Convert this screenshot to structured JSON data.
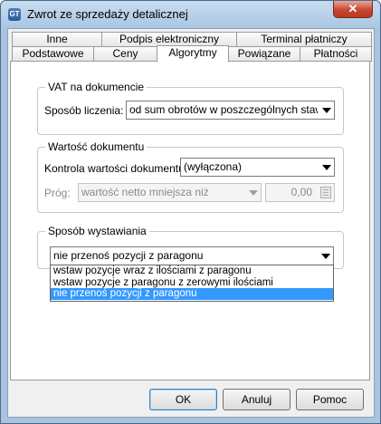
{
  "window": {
    "title": "Zwrot ze sprzedaży detalicznej",
    "close_glyph": "✕",
    "app_icon_text": "GT"
  },
  "tabs_row1": [
    {
      "label": "Inne"
    },
    {
      "label": "Podpis elektroniczny"
    },
    {
      "label": "Terminal płatniczy"
    }
  ],
  "tabs_row2": [
    {
      "label": "Podstawowe"
    },
    {
      "label": "Ceny"
    },
    {
      "label": "Algorytmy"
    },
    {
      "label": "Powiązane"
    },
    {
      "label": "Płatności"
    }
  ],
  "active_tab": "Algorytmy",
  "vat": {
    "legend": "VAT na dokumencie",
    "method_label": "Sposób liczenia:",
    "method_value": "od sum obrotów w poszczególnych stawkac"
  },
  "value": {
    "legend": "Wartość dokumentu",
    "control_label": "Kontrola wartości dokumentu:",
    "control_value": "(wyłączona)",
    "threshold_label": "Próg:",
    "threshold_type": "wartość netto mniejsza niż",
    "threshold_amount": "0,00"
  },
  "issue": {
    "legend": "Sposób wystawiania",
    "selected": "nie przenoś pozycji z paragonu",
    "options": [
      "wstaw pozycje wraz z ilościami z paragonu",
      "wstaw pozycje z paragonu z zerowymi ilościami",
      "nie przenoś pozycji z paragonu"
    ]
  },
  "buttons": {
    "ok": "OK",
    "cancel": "Anuluj",
    "help": "Pomoc"
  }
}
